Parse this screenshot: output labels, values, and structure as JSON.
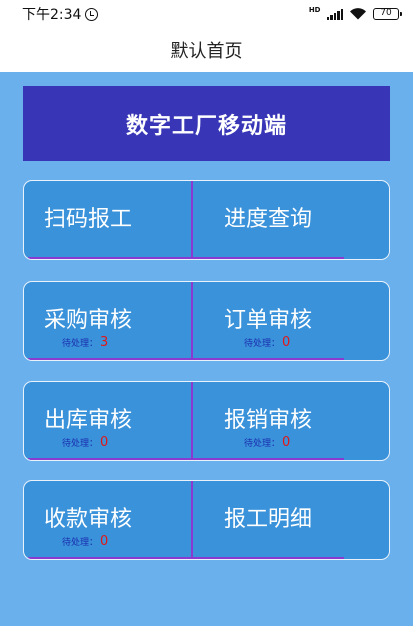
{
  "status_bar": {
    "time": "下午2:34",
    "network": "HD",
    "battery": "70"
  },
  "nav": {
    "title": "默认首页"
  },
  "banner": {
    "title": "数字工厂移动端"
  },
  "pending_label": "待处理：",
  "cards": [
    {
      "left": {
        "label": "扫码报工",
        "pending": null
      },
      "right": {
        "label": "进度查询",
        "pending": null
      }
    },
    {
      "left": {
        "label": "采购审核",
        "pending": "3"
      },
      "right": {
        "label": "订单审核",
        "pending": "0"
      }
    },
    {
      "left": {
        "label": "出库审核",
        "pending": "0"
      },
      "right": {
        "label": "报销审核",
        "pending": "0"
      }
    },
    {
      "left": {
        "label": "收款审核",
        "pending": "0"
      },
      "right": {
        "label": "报工明细",
        "pending": null
      }
    }
  ],
  "colors": {
    "page_bg": "#6ab0ec",
    "banner_bg": "#3836b6",
    "card_bg": "#3a92da",
    "divider": "#8a3ad0",
    "pending_text": "#1a2fb0",
    "pending_count": "#e01818"
  }
}
